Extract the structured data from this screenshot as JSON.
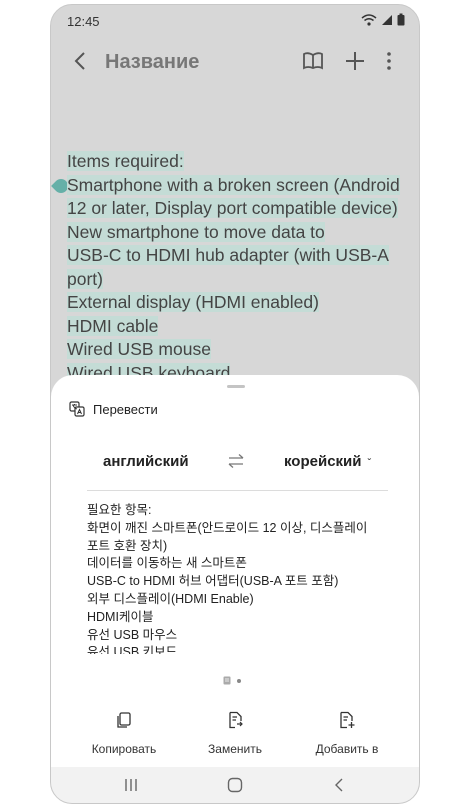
{
  "status_bar": {
    "time": "12:45"
  },
  "app_bar": {
    "title": "Название"
  },
  "note": {
    "lines": [
      "Items required:",
      "Smartphone with a broken screen (Android",
      "12 or later, Display port compatible device)",
      "New smartphone to move data to",
      "USB-C to HDMI hub adapter (with USB-A",
      "port)",
      "External display (HDMI enabled)",
      "HDMI cable",
      "Wired USB mouse",
      "Wired USB keyboard"
    ]
  },
  "translate_sheet": {
    "header_label": "Перевести",
    "source_language": "английский",
    "target_language": "корейский",
    "translated_lines": [
      "필요한 항목:",
      "화면이 깨진 스마트폰(안드로이드 12 이상, 디스플레이",
      "포트 호환 장치)",
      "데이터를 이동하는 새 스마트폰",
      "USB-C to HDMI 허브 어댑터(USB-A 포트 포함)",
      "외부 디스플레이(HDMI Enable)",
      "HDMI케이블",
      "유선 USB 마우스",
      "유선 USB 키보드"
    ],
    "actions": {
      "copy": "Копировать",
      "replace": "Заменить",
      "add_to": "Добавить в"
    }
  },
  "colors": {
    "highlight": "#c4dcd6",
    "handle": "#66b0a8",
    "sheet_bg": "#ffffff",
    "dim_bg": "#d7d7d7"
  }
}
